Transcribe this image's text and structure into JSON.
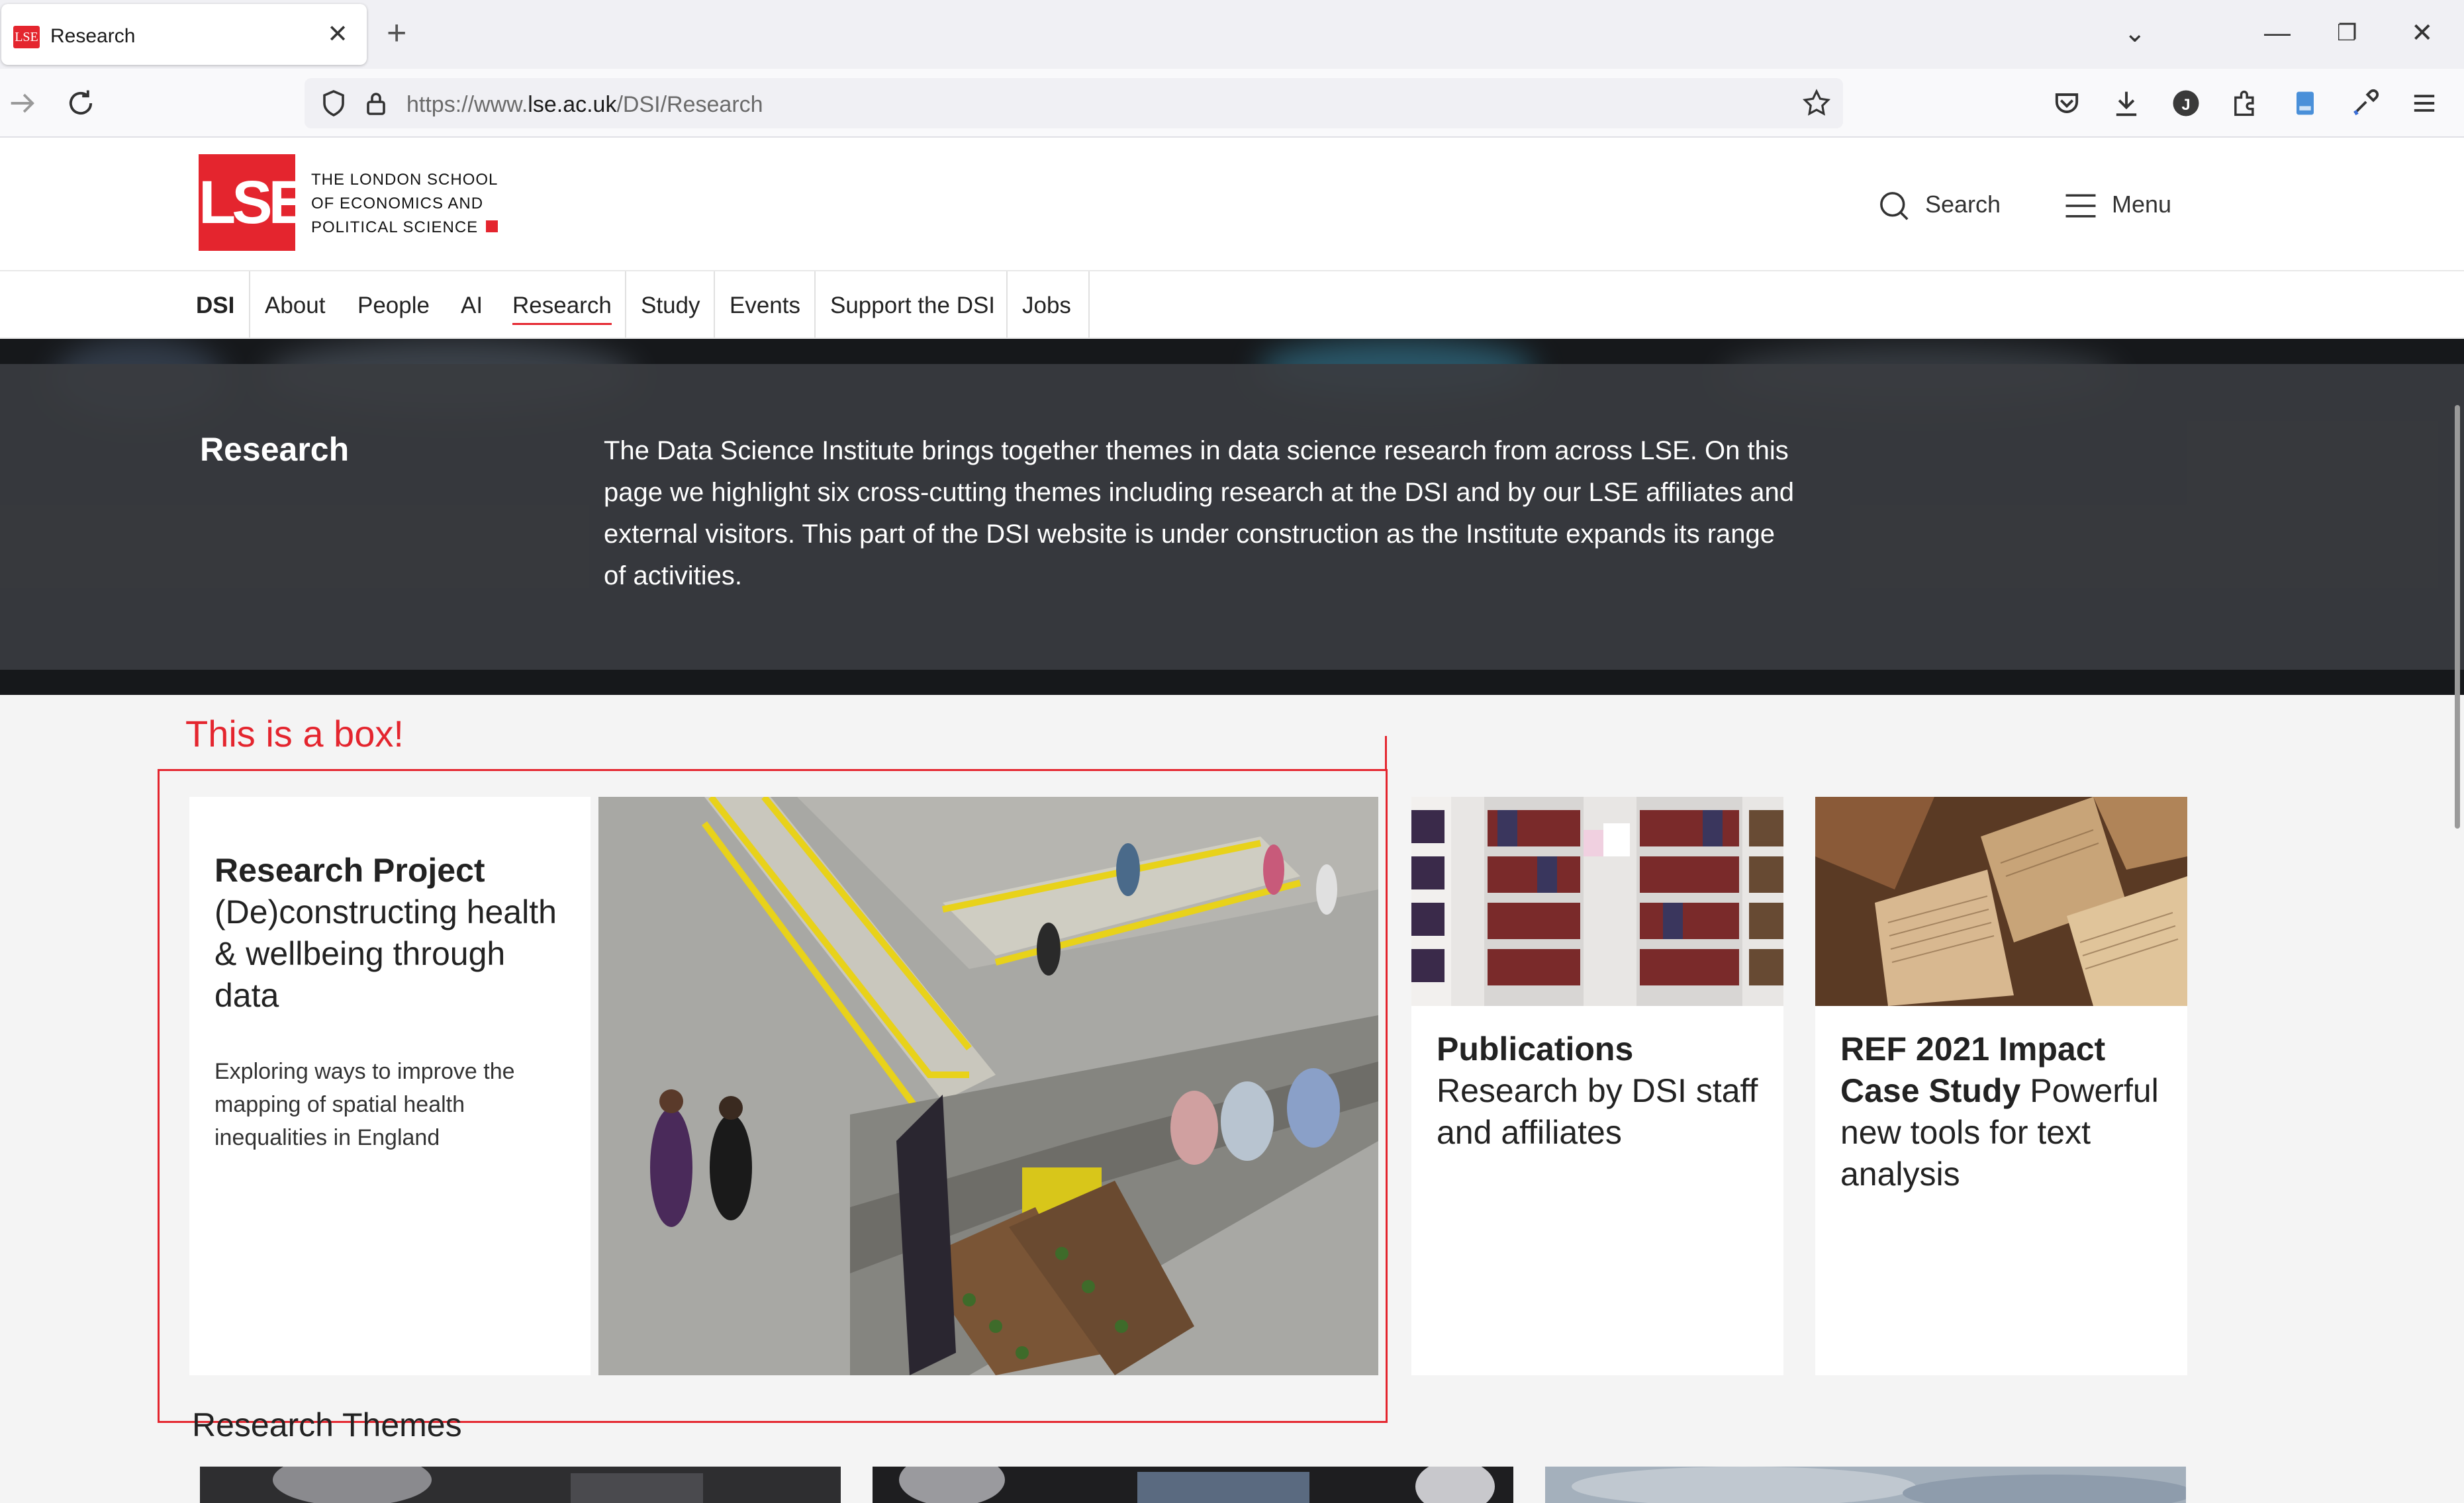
{
  "browser": {
    "tab_title": "Research",
    "url_prefix": "https://www.",
    "url_domain": "lse.ac.uk",
    "url_path": "/DSI/Research"
  },
  "header": {
    "logo_text": "LSE",
    "school_line1": "THE LONDON SCHOOL",
    "school_line2": "OF ECONOMICS AND",
    "school_line3": "POLITICAL SCIENCE",
    "search_label": "Search",
    "menu_label": "Menu"
  },
  "subnav": {
    "items": [
      "DSI",
      "About",
      "People",
      "AI",
      "Research",
      "Study",
      "Events",
      "Support the DSI",
      "Jobs"
    ]
  },
  "hero": {
    "title": "Research",
    "text": "The Data Science Institute brings together themes in data science research from across LSE. On this page we highlight six cross-cutting themes including research at the DSI and by our LSE affiliates and external visitors. This part of the DSI website is under construction as the Institute expands its range of activities."
  },
  "annotation": {
    "label": "This is a box!"
  },
  "feature": {
    "title_bold": "Research Project",
    "title_rest": "(De)constructing health & wellbeing through data",
    "description": "Exploring ways to improve the mapping of spatial health inequalities in England"
  },
  "cards": [
    {
      "title_bold": "Publications",
      "title_rest": "Research by DSI staff and affiliates"
    },
    {
      "title_bold": "REF 2021 Impact Case Study",
      "title_rest": "Powerful new tools for text analysis"
    }
  ],
  "themes": {
    "title": "Research Themes"
  },
  "colors": {
    "brand_red": "#e4252e",
    "hero_bg": "#3a3c40"
  }
}
